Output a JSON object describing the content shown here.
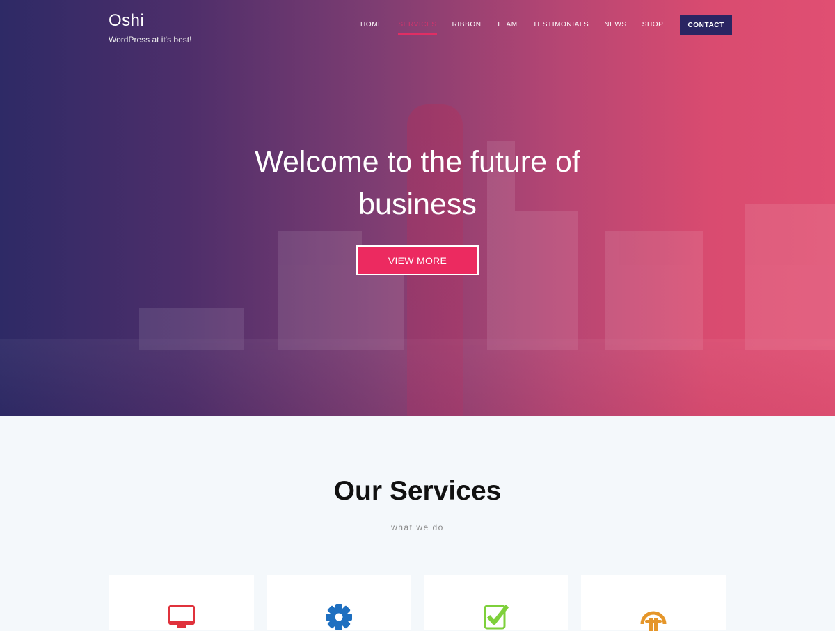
{
  "site": {
    "title": "Oshi",
    "tagline": "WordPress at it's best!"
  },
  "nav": {
    "items": [
      {
        "label": "HOME",
        "active": false
      },
      {
        "label": "SERVICES",
        "active": true
      },
      {
        "label": "RIBBON",
        "active": false
      },
      {
        "label": "TEAM",
        "active": false
      },
      {
        "label": "TESTIMONIALS",
        "active": false
      },
      {
        "label": "NEWS",
        "active": false
      },
      {
        "label": "SHOP",
        "active": false
      }
    ],
    "contact_label": "CONTACT"
  },
  "hero": {
    "title_line1": "Welcome to the future of",
    "title_line2": "business",
    "button_label": "VIEW MORE"
  },
  "services": {
    "title": "Our Services",
    "subtitle": "what we do",
    "cards": [
      {
        "icon": "monitor-icon",
        "color": "#e0323c"
      },
      {
        "icon": "gear-icon",
        "color": "#1e6fc0"
      },
      {
        "icon": "checkbox-icon",
        "color": "#7ed03b"
      },
      {
        "icon": "headphones-icon",
        "color": "#e5962a"
      }
    ]
  },
  "colors": {
    "accent": "#ec2a60",
    "contact_bg": "#2a2562",
    "gradient_start": "#2e2a66",
    "gradient_end": "#e04f72",
    "section_bg": "#f4f8fb"
  }
}
